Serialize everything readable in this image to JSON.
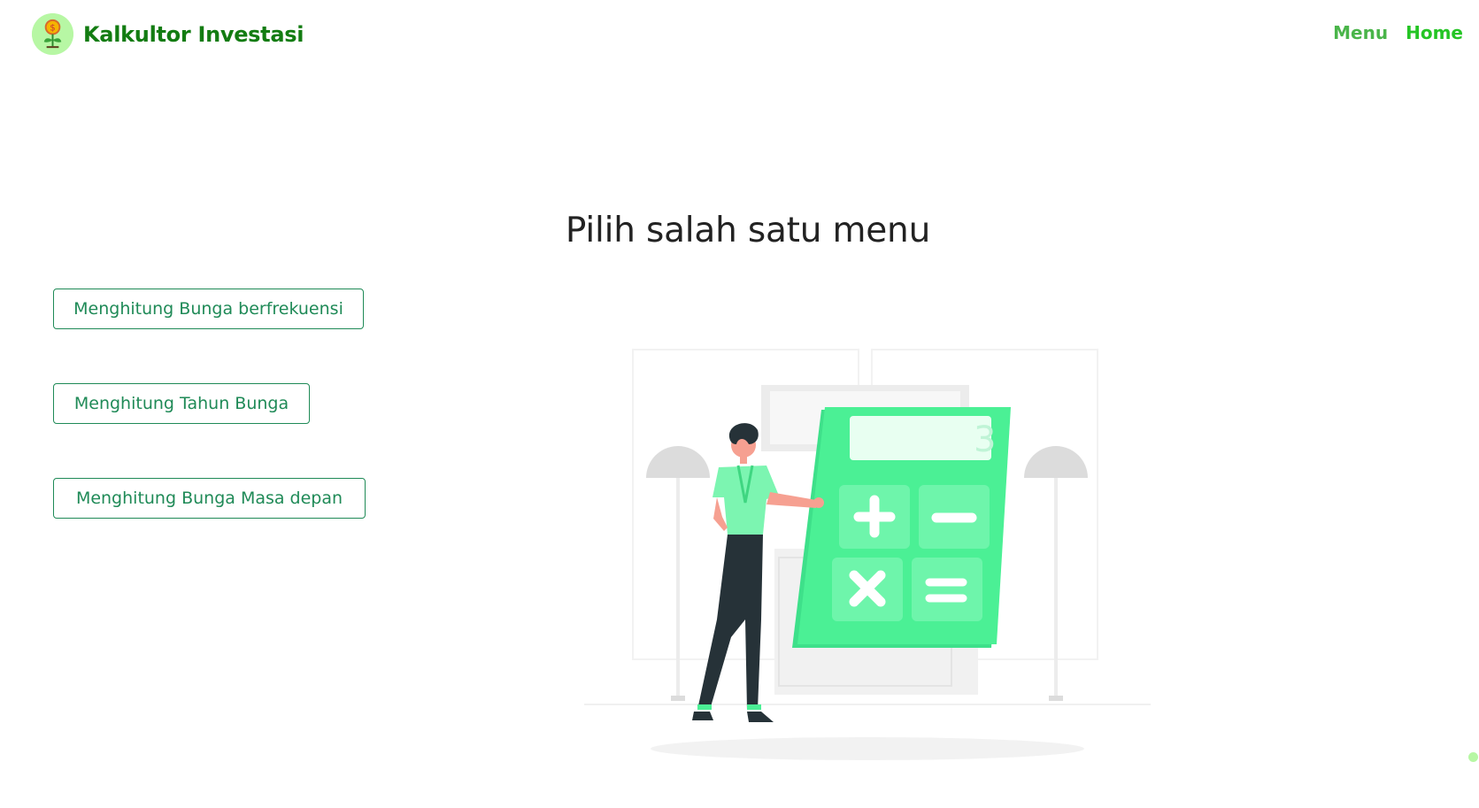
{
  "navbar": {
    "brand": "Kalkultor Investasi",
    "logo_icon": "money-plant-icon",
    "links": [
      {
        "label": "Menu"
      },
      {
        "label": "Home"
      }
    ]
  },
  "main": {
    "title": "Pilih salah satu menu",
    "menu_buttons": [
      {
        "label": "Menghitung Bunga berfrekuensi"
      },
      {
        "label": "Menghitung Tahun Bunga"
      },
      {
        "label": "Menghitung Bunga Masa depan"
      }
    ],
    "illustration": "person-with-calculator-illustration"
  },
  "colors": {
    "brand_green": "#137c12",
    "nav_green": "#4ab54a",
    "button_border": "#1f8a57",
    "calculator_green": "#4bf095"
  }
}
